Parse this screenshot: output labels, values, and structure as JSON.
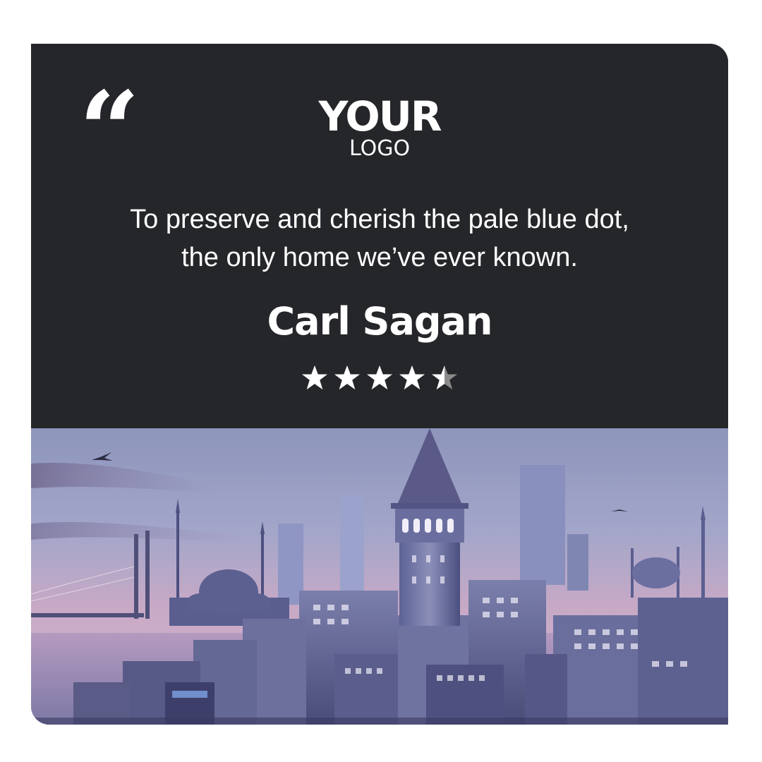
{
  "logo": {
    "main": "YOUR",
    "sub": "LOGO"
  },
  "quote": {
    "mark": "“",
    "line1": "To preserve and cherish the pale blue dot,",
    "line2": "the only home we’ve ever known."
  },
  "author": "Carl Sagan",
  "rating": {
    "value": 4.5,
    "max": 5
  },
  "photo": {
    "subject": "istanbul-skyline-galata-tower"
  },
  "colors": {
    "panel": "#25262a",
    "text": "#ffffff",
    "star_filled": "#ffffff",
    "star_empty": "#8a8a8a"
  }
}
